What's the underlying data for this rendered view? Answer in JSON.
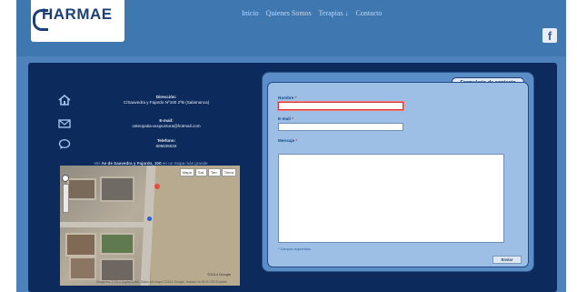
{
  "header": {
    "logo_text": "HARMAE",
    "nav": [
      "Inicio",
      "Quienes Somos",
      "Terapias ↓",
      "Contacto"
    ],
    "facebook_glyph": "f"
  },
  "contact": {
    "address_label": "Dirección:",
    "address_value": "C/Saavedra y Fajardo Nº100 2ºB (Salamanca)",
    "email_label": "E-mail:",
    "email_value": "osteopatia-acupuntura@hotmail.com",
    "phone_label": "Telefono:",
    "phone_value": "605635534"
  },
  "map": {
    "caption_prefix": "Ver",
    "caption_place": "Av de Saavedra y Fajardo, 100",
    "caption_suffix": "en un mapa más grande",
    "buttons": [
      "Mapa",
      "Sat.",
      "Terr.",
      "Tierra"
    ],
    "google_mark": "©2014 Google",
    "copyright": "Imágenes ©2014 DigitalGlobe, Datos del mapa ©2014 Google, basado en BCN IGN España"
  },
  "form": {
    "title": "Formulario de contacto",
    "name_label": "Nombre",
    "email_label": "E-mail",
    "message_label": "Mensaje",
    "required_mark": "*",
    "required_note": "* Campos requeridos",
    "submit_label": "Enviar"
  },
  "colors": {
    "page_blue": "#4e82bd",
    "panel_navy": "#0c2a5c",
    "form_bg": "#9dbfe6",
    "invalid_border": "#d33333"
  }
}
